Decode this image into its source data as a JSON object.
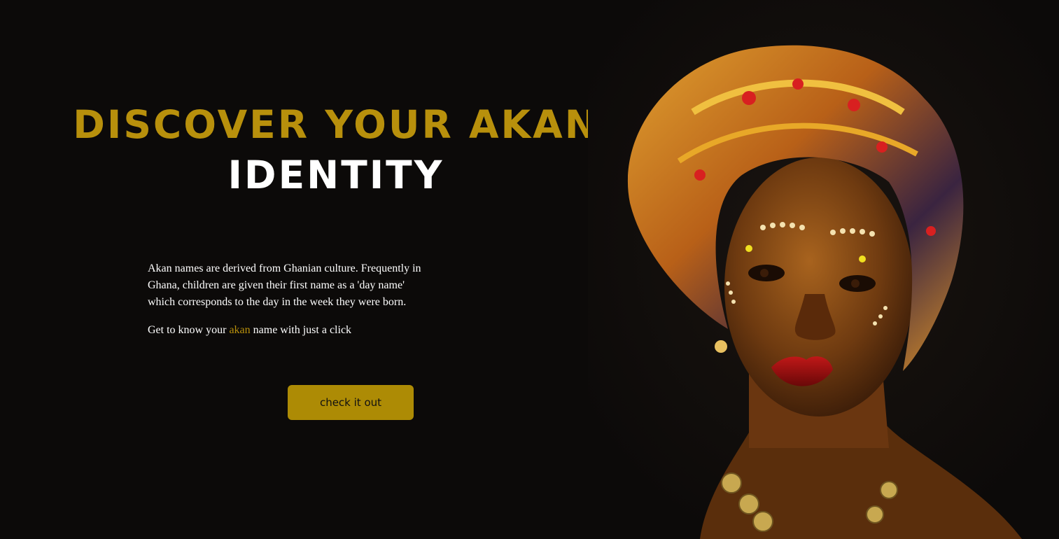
{
  "hero": {
    "title_part1": "DISCOVER YOUR AKAN",
    "title_part2": "IDENTITY",
    "description": "Akan names are derived from Ghanian culture. Frequently in Ghana, children are given their first name as a 'day name' which corresponds to the day in the week they were born.",
    "tagline_before": "Get to know your ",
    "tagline_accent": "akan",
    "tagline_after": " name with just a click",
    "cta_label": "check it out"
  },
  "colors": {
    "background": "#0c0a09",
    "accent_gold": "#b8900c",
    "button_gold": "#ad8b05",
    "text": "#ffffff"
  },
  "image": {
    "subject": "portrait-woman-headwrap"
  }
}
